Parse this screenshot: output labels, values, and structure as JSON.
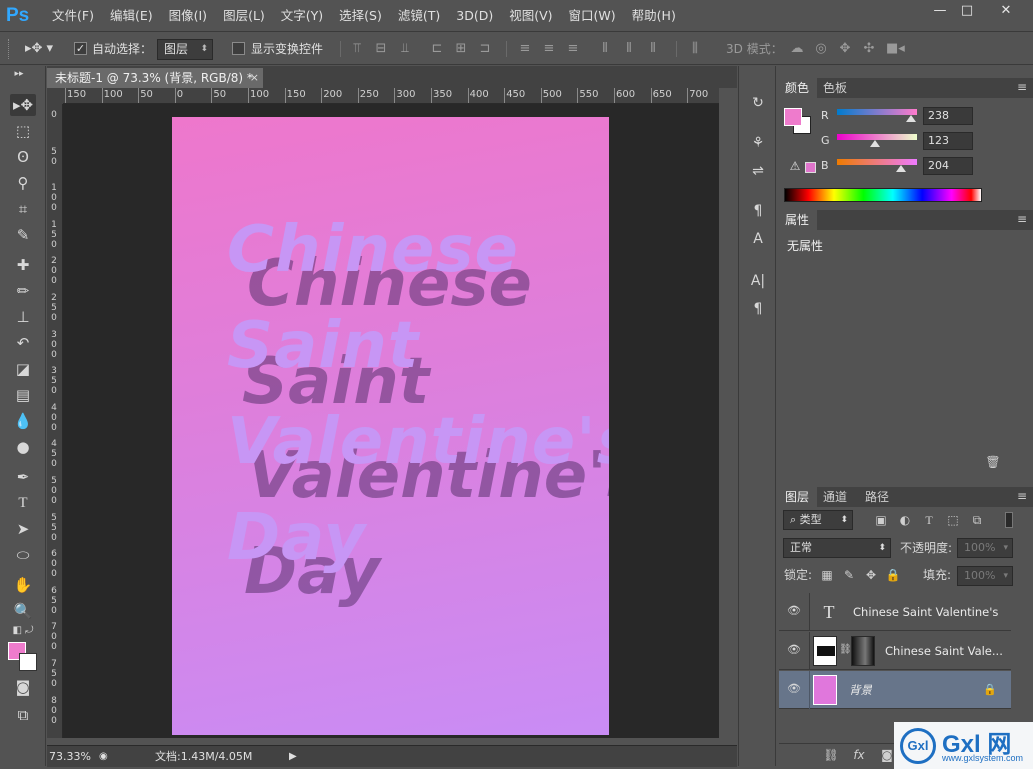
{
  "app": {
    "logo": "Ps"
  },
  "menu": [
    "文件(F)",
    "编辑(E)",
    "图像(I)",
    "图层(L)",
    "文字(Y)",
    "选择(S)",
    "滤镜(T)",
    "3D(D)",
    "视图(V)",
    "窗口(W)",
    "帮助(H)"
  ],
  "window_controls": {
    "minimize": "—",
    "maximize": "□",
    "close": "✕"
  },
  "options": {
    "auto_select_label": "自动选择：",
    "auto_select_checked": true,
    "layer_select_value": "图层",
    "show_transform_label": "显示变换控件",
    "mode_3d_label": "3D 模式："
  },
  "document": {
    "tab_title": "未标题-1 @ 73.3% (背景, RGB/8) *",
    "close_glyph": "×",
    "zoom": "73.33%",
    "doc_size": "文档:1.43M/4.05M"
  },
  "ruler_h_labels": [
    "150",
    "100",
    "50",
    "0",
    "50",
    "100",
    "150",
    "200",
    "250",
    "300",
    "350",
    "400",
    "450",
    "500",
    "550",
    "600",
    "650",
    "700"
  ],
  "ruler_v_labels": [
    "0",
    "5 0",
    "1 0 0",
    "1 5 0",
    "2 0 0",
    "2 5 0",
    "3 0 0",
    "3 5 0",
    "4 0 0",
    "4 5 0",
    "5 0 0",
    "5 5 0",
    "6 0 0",
    "6 5 0",
    "7 0 0",
    "7 5 0",
    "8 0 0"
  ],
  "artwork": {
    "lines": [
      "Chinese",
      "Saint",
      "Valentine's",
      "Day"
    ]
  },
  "color_panel": {
    "tabs": [
      "颜色",
      "色板"
    ],
    "r_label": "R",
    "g_label": "G",
    "b_label": "B",
    "r": "238",
    "g": "123",
    "b": "204",
    "r_fraction": 0.93,
    "g_fraction": 0.48,
    "b_fraction": 0.8,
    "foreground": "#ee7bcc",
    "warning_icon": "⚠"
  },
  "properties_panel": {
    "tab": "属性",
    "empty_text": "无属性"
  },
  "layers_panel": {
    "tabs": [
      "图层",
      "通道",
      "路径"
    ],
    "filter_type": "类型",
    "blend_mode": "正常",
    "opacity_label": "不透明度:",
    "opacity_value": "100%",
    "lock_label": "锁定:",
    "fill_label": "填充:",
    "fill_value": "100%",
    "layers": [
      {
        "name": "Chinese Saint Valentine's ...",
        "kind": "text",
        "selected": false
      },
      {
        "name": "Chinese Saint Vale...",
        "kind": "masked",
        "selected": false
      },
      {
        "name": "背景",
        "kind": "background",
        "selected": true,
        "locked": true
      }
    ],
    "footer_icons": [
      "link-icon",
      "fx-icon",
      "mask-icon"
    ]
  },
  "watermark": {
    "logo": "Gxl",
    "brand": "Gxl 网",
    "url": "www.gxlsystem.com"
  }
}
